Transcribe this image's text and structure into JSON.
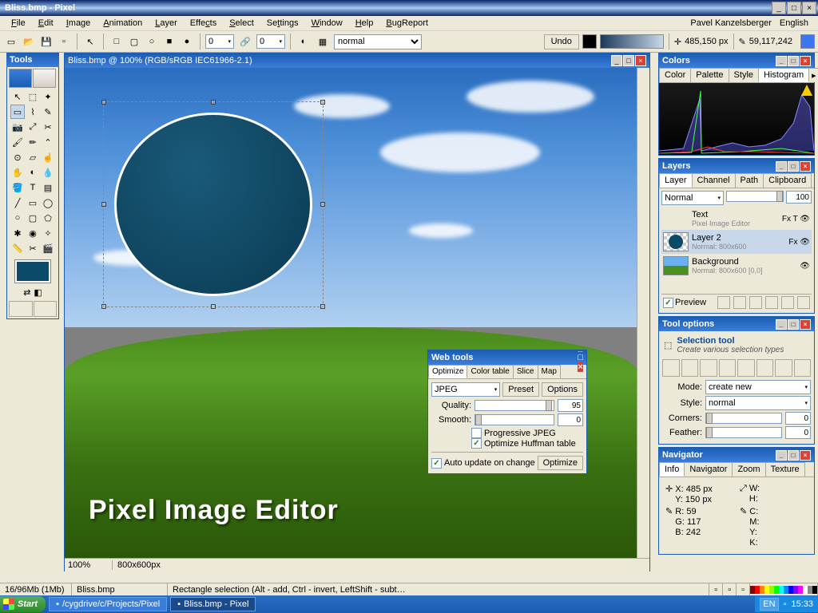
{
  "titlebar": {
    "title": "Bliss.bmp - Pixel"
  },
  "menubar": {
    "items": [
      "File",
      "Edit",
      "Image",
      "Animation",
      "Layer",
      "Effects",
      "Select",
      "Settings",
      "Window",
      "Help",
      "BugReport"
    ],
    "user": "Pavel Kanzelsberger",
    "lang": "English"
  },
  "toolbar": {
    "num1": "0",
    "num2": "0",
    "blend": "normal",
    "undo": "Undo",
    "coord": "485,150 px",
    "color_rgb": "59,117,242"
  },
  "tools_panel": {
    "title": "Tools"
  },
  "canvas": {
    "title": "Bliss.bmp @ 100% (RGB/sRGB IEC61966-2.1)",
    "text_overlay": "Pixel  Image  Editor",
    "zoom": "100%",
    "dims": "800x600px"
  },
  "webtools": {
    "title": "Web tools",
    "tabs": [
      "Optimize",
      "Color table",
      "Slice",
      "Map"
    ],
    "format": "JPEG",
    "preset_btn": "Preset",
    "options_btn": "Options",
    "quality_lbl": "Quality:",
    "quality_val": "95",
    "smooth_lbl": "Smooth:",
    "smooth_val": "0",
    "progressive": "Progressive JPEG",
    "huffman": "Optimize Huffman table",
    "auto_update": "Auto update on change",
    "optimize_btn": "Optimize"
  },
  "colors": {
    "title": "Colors",
    "tabs": [
      "Color",
      "Palette",
      "Style",
      "Histogram"
    ]
  },
  "layers": {
    "title": "Layers",
    "tabs": [
      "Layer",
      "Channel",
      "Path",
      "Clipboard"
    ],
    "blend": "Normal",
    "opacity": "100",
    "items": [
      {
        "name": "Text",
        "meta": "Pixel Image Editor",
        "badge": "Fx T"
      },
      {
        "name": "Layer 2",
        "meta": "Normal: 800x600",
        "badge": "Fx"
      },
      {
        "name": "Background",
        "meta": "Normal: 800x600 [0,0]",
        "badge": ""
      }
    ],
    "preview": "Preview"
  },
  "tool_options": {
    "title": "Tool options",
    "heading": "Selection tool",
    "sub": "Create various selection types",
    "mode_lbl": "Mode:",
    "mode_val": "create new",
    "style_lbl": "Style:",
    "style_val": "normal",
    "corners_lbl": "Corners:",
    "corners_val": "0",
    "feather_lbl": "Feather:",
    "feather_val": "0"
  },
  "navigator": {
    "title": "Navigator",
    "tabs": [
      "Info",
      "Navigator",
      "Zoom",
      "Texture"
    ],
    "x": "X: 485 px",
    "y": "Y: 150 px",
    "w": "W:",
    "h": "H:",
    "r": "R: 59",
    "g": "G: 117",
    "b": "B: 242",
    "c": "C:",
    "m": "M:",
    "ylw": "Y:",
    "k": "K:"
  },
  "statusbar": {
    "mem": "16/96Mb (1Mb)",
    "file": "Bliss.bmp",
    "hint": "Rectangle selection (Alt - add, Ctrl - invert, LeftShift - subt…"
  },
  "taskbar": {
    "start": "Start",
    "tasks": [
      "/cygdrive/c/Projects/Pixel",
      "Bliss.bmp - Pixel"
    ],
    "lang": "EN",
    "time": "15:33"
  }
}
